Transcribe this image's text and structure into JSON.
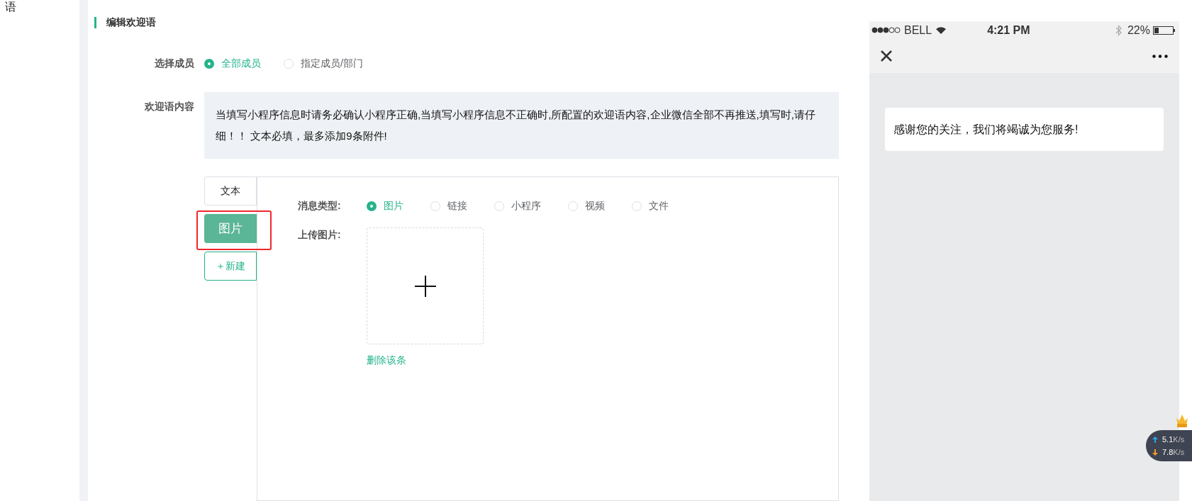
{
  "sidebar_fragment": "语",
  "section_title": "编辑欢迎语",
  "member_field": {
    "label": "选择成员",
    "options": [
      {
        "label": "全部成员",
        "selected": true
      },
      {
        "label": "指定成员/部门",
        "selected": false
      }
    ]
  },
  "content_field": {
    "label": "欢迎语内容",
    "notice": "当填写小程序信息时请务必确认小程序正确,当填写小程序信息不正确时,所配置的欢迎语内容,企业微信全部不再推送,填写时,请仔细！！ 文本必填，最多添加9条附件!"
  },
  "attachment_tabs": [
    {
      "label": "文本",
      "selected": false,
      "highlighted": false
    },
    {
      "label": "图片",
      "selected": true,
      "highlighted": true
    }
  ],
  "new_button": "＋新建",
  "message_type": {
    "label": "消息类型:",
    "options": [
      {
        "label": "图片",
        "selected": true
      },
      {
        "label": "链接",
        "selected": false
      },
      {
        "label": "小程序",
        "selected": false
      },
      {
        "label": "视频",
        "selected": false
      },
      {
        "label": "文件",
        "selected": false
      }
    ]
  },
  "upload": {
    "label": "上传图片:"
  },
  "delete_link": "删除该条",
  "phone_preview": {
    "carrier": "BELL",
    "time": "4:21 PM",
    "battery": "22%",
    "message": "感谢您的关注，我们将竭诚为您服务!"
  },
  "network_widget": {
    "upload_speed": "5.1",
    "upload_unit": "K/s",
    "download_speed": "7.8",
    "download_unit": "K/s"
  }
}
